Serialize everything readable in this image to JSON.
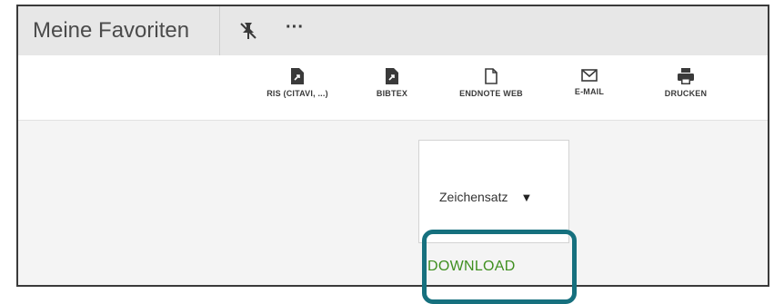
{
  "panel": {
    "title": "Meine Favoriten",
    "more_label": "···"
  },
  "toolbar": {
    "items": [
      {
        "label": "RIS (CITAVI, ...)",
        "icon": "file-export-icon"
      },
      {
        "label": "BIBTEX",
        "icon": "file-export-icon"
      },
      {
        "label": "ENDNOTE WEB",
        "icon": "file-outline-icon"
      },
      {
        "label": "E-MAIL",
        "icon": "envelope-icon"
      },
      {
        "label": "DRUCKEN",
        "icon": "printer-icon"
      }
    ]
  },
  "dialog": {
    "charset_label": "Zeichensatz",
    "caret": "▼",
    "download_label": "DOWNLOAD"
  },
  "colors": {
    "download_text": "#3f8f1f",
    "highlight_border": "#16707e"
  }
}
